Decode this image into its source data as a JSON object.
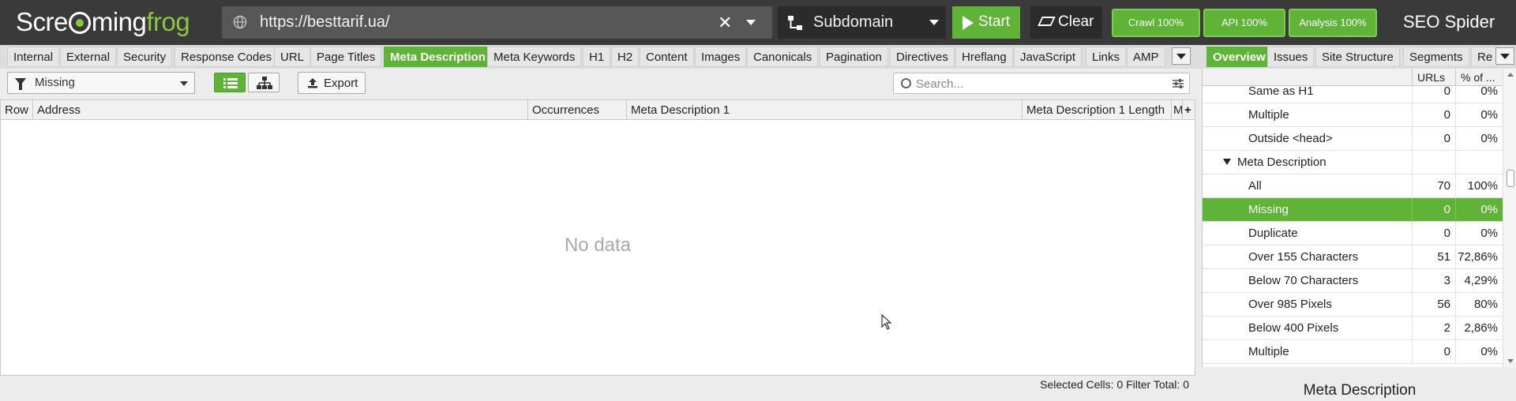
{
  "app": {
    "logo": {
      "part1": "Scre",
      "part2": "ming",
      "part3": "frog"
    },
    "product": "SEO Spider"
  },
  "urlbar": {
    "url": "https://besttarif.ua/",
    "clear": "✕"
  },
  "mode": {
    "label": "Subdomain"
  },
  "actions": {
    "start": "Start",
    "clear": "Clear"
  },
  "status_pills": [
    {
      "label": "Crawl 100%"
    },
    {
      "label": "API 100%"
    },
    {
      "label": "Analysis 100%"
    }
  ],
  "tabs": [
    {
      "label": "Internal"
    },
    {
      "label": "External"
    },
    {
      "label": "Security"
    },
    {
      "label": "Response Codes"
    },
    {
      "label": "URL"
    },
    {
      "label": "Page Titles"
    },
    {
      "label": "Meta Description",
      "active": true
    },
    {
      "label": "Meta Keywords"
    },
    {
      "label": "H1"
    },
    {
      "label": "H2"
    },
    {
      "label": "Content"
    },
    {
      "label": "Images"
    },
    {
      "label": "Canonicals"
    },
    {
      "label": "Pagination"
    },
    {
      "label": "Directives"
    },
    {
      "label": "Hreflang"
    },
    {
      "label": "JavaScript"
    },
    {
      "label": "Links"
    },
    {
      "label": "AMP"
    }
  ],
  "toolbar": {
    "filter": "Missing",
    "export": "Export",
    "search_placeholder": "Search..."
  },
  "table": {
    "columns": [
      "Row",
      "Address",
      "Occurrences",
      "Meta Description 1",
      "Meta Description 1 Length",
      "M"
    ],
    "empty_text": "No data"
  },
  "statusbar": {
    "text": "Selected Cells:  0  Filter Total:  0"
  },
  "right_tabs": [
    {
      "label": "Overview",
      "active": true
    },
    {
      "label": "Issues"
    },
    {
      "label": "Site Structure"
    },
    {
      "label": "Segments"
    },
    {
      "label": "Re"
    }
  ],
  "overview": {
    "col_urls": "URLs",
    "col_pct": "% of ...",
    "rows": [
      {
        "label": "Same as H1",
        "urls": "0",
        "pct": "0%",
        "indent": 2
      },
      {
        "label": "Multiple",
        "urls": "0",
        "pct": "0%",
        "indent": 2
      },
      {
        "label": "Outside <head>",
        "urls": "0",
        "pct": "0%",
        "indent": 2
      },
      {
        "label": "Meta Description",
        "urls": "",
        "pct": "",
        "indent": 1,
        "group": true
      },
      {
        "label": "All",
        "urls": "70",
        "pct": "100%",
        "indent": 2
      },
      {
        "label": "Missing",
        "urls": "0",
        "pct": "0%",
        "indent": 2,
        "selected": true
      },
      {
        "label": "Duplicate",
        "urls": "0",
        "pct": "0%",
        "indent": 2
      },
      {
        "label": "Over 155 Characters",
        "urls": "51",
        "pct": "72,86%",
        "indent": 2
      },
      {
        "label": "Below 70 Characters",
        "urls": "3",
        "pct": "4,29%",
        "indent": 2
      },
      {
        "label": "Over 985 Pixels",
        "urls": "56",
        "pct": "80%",
        "indent": 2
      },
      {
        "label": "Below 400 Pixels",
        "urls": "2",
        "pct": "2,86%",
        "indent": 2
      },
      {
        "label": "Multiple",
        "urls": "0",
        "pct": "0%",
        "indent": 2
      }
    ],
    "footer_title": "Meta Description"
  },
  "colors": {
    "accent": "#5fb336",
    "topbar": "#3a3a3a"
  }
}
